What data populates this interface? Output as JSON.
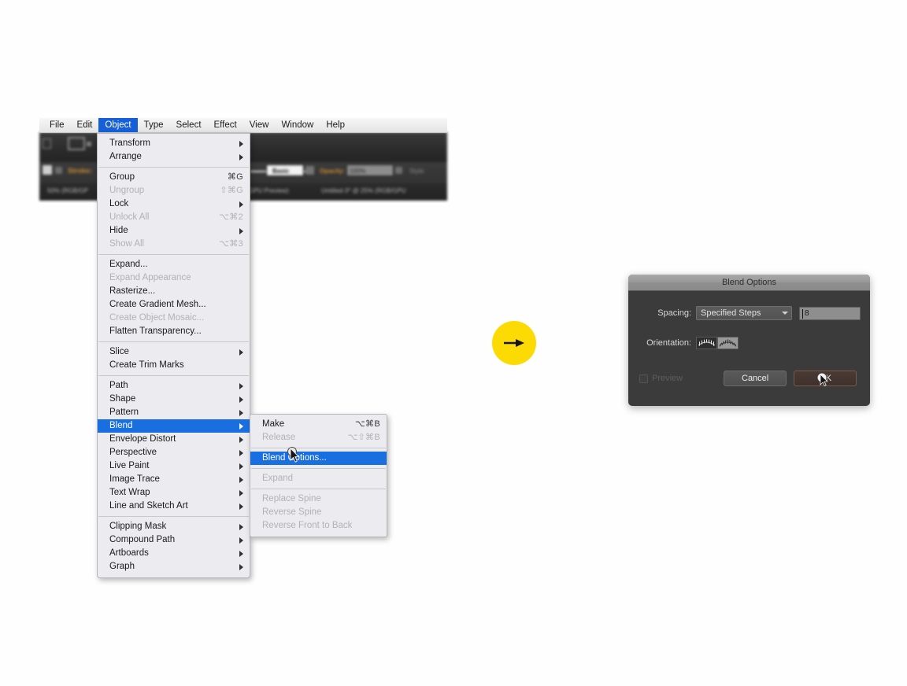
{
  "menubar": {
    "items": [
      {
        "label": "File",
        "active": false
      },
      {
        "label": "Edit",
        "active": false
      },
      {
        "label": "Object",
        "active": true
      },
      {
        "label": "Type",
        "active": false
      },
      {
        "label": "Select",
        "active": false
      },
      {
        "label": "Effect",
        "active": false
      },
      {
        "label": "View",
        "active": false
      },
      {
        "label": "Window",
        "active": false
      },
      {
        "label": "Help",
        "active": false
      }
    ]
  },
  "app_chrome": {
    "stroke_label": "Stroke:",
    "basic_label": "Basic",
    "opacity_label": "Opacity:",
    "opacity_value": "100%",
    "style_label": "Style:",
    "zoom_status": "50% (RGB/GP",
    "gpu_preview": "GPU Preview)",
    "document_tab": "Untitled-3* @ 25% (RGB/GPU"
  },
  "object_menu": {
    "groups": [
      [
        {
          "label": "Transform",
          "shortcut": "",
          "submenu": true,
          "disabled": false,
          "selected": false
        },
        {
          "label": "Arrange",
          "shortcut": "",
          "submenu": true,
          "disabled": false,
          "selected": false
        }
      ],
      [
        {
          "label": "Group",
          "shortcut": "⌘G",
          "submenu": false,
          "disabled": false,
          "selected": false
        },
        {
          "label": "Ungroup",
          "shortcut": "⇧⌘G",
          "submenu": false,
          "disabled": true,
          "selected": false
        },
        {
          "label": "Lock",
          "shortcut": "",
          "submenu": true,
          "disabled": false,
          "selected": false
        },
        {
          "label": "Unlock All",
          "shortcut": "⌥⌘2",
          "submenu": false,
          "disabled": true,
          "selected": false
        },
        {
          "label": "Hide",
          "shortcut": "",
          "submenu": true,
          "disabled": false,
          "selected": false
        },
        {
          "label": "Show All",
          "shortcut": "⌥⌘3",
          "submenu": false,
          "disabled": true,
          "selected": false
        }
      ],
      [
        {
          "label": "Expand...",
          "shortcut": "",
          "submenu": false,
          "disabled": false,
          "selected": false
        },
        {
          "label": "Expand Appearance",
          "shortcut": "",
          "submenu": false,
          "disabled": true,
          "selected": false
        },
        {
          "label": "Rasterize...",
          "shortcut": "",
          "submenu": false,
          "disabled": false,
          "selected": false
        },
        {
          "label": "Create Gradient Mesh...",
          "shortcut": "",
          "submenu": false,
          "disabled": false,
          "selected": false
        },
        {
          "label": "Create Object Mosaic...",
          "shortcut": "",
          "submenu": false,
          "disabled": true,
          "selected": false
        },
        {
          "label": "Flatten Transparency...",
          "shortcut": "",
          "submenu": false,
          "disabled": false,
          "selected": false
        }
      ],
      [
        {
          "label": "Slice",
          "shortcut": "",
          "submenu": true,
          "disabled": false,
          "selected": false
        },
        {
          "label": "Create Trim Marks",
          "shortcut": "",
          "submenu": false,
          "disabled": false,
          "selected": false
        }
      ],
      [
        {
          "label": "Path",
          "shortcut": "",
          "submenu": true,
          "disabled": false,
          "selected": false
        },
        {
          "label": "Shape",
          "shortcut": "",
          "submenu": true,
          "disabled": false,
          "selected": false
        },
        {
          "label": "Pattern",
          "shortcut": "",
          "submenu": true,
          "disabled": false,
          "selected": false
        },
        {
          "label": "Blend",
          "shortcut": "",
          "submenu": true,
          "disabled": false,
          "selected": true
        },
        {
          "label": "Envelope Distort",
          "shortcut": "",
          "submenu": true,
          "disabled": false,
          "selected": false
        },
        {
          "label": "Perspective",
          "shortcut": "",
          "submenu": true,
          "disabled": false,
          "selected": false
        },
        {
          "label": "Live Paint",
          "shortcut": "",
          "submenu": true,
          "disabled": false,
          "selected": false
        },
        {
          "label": "Image Trace",
          "shortcut": "",
          "submenu": true,
          "disabled": false,
          "selected": false
        },
        {
          "label": "Text Wrap",
          "shortcut": "",
          "submenu": true,
          "disabled": false,
          "selected": false
        },
        {
          "label": "Line and Sketch Art",
          "shortcut": "",
          "submenu": true,
          "disabled": false,
          "selected": false
        }
      ],
      [
        {
          "label": "Clipping Mask",
          "shortcut": "",
          "submenu": true,
          "disabled": false,
          "selected": false
        },
        {
          "label": "Compound Path",
          "shortcut": "",
          "submenu": true,
          "disabled": false,
          "selected": false
        },
        {
          "label": "Artboards",
          "shortcut": "",
          "submenu": true,
          "disabled": false,
          "selected": false
        },
        {
          "label": "Graph",
          "shortcut": "",
          "submenu": true,
          "disabled": false,
          "selected": false
        }
      ]
    ]
  },
  "blend_submenu": {
    "groups": [
      [
        {
          "label": "Make",
          "shortcut": "⌥⌘B",
          "submenu": false,
          "disabled": false,
          "selected": false
        },
        {
          "label": "Release",
          "shortcut": "⌥⇧⌘B",
          "submenu": false,
          "disabled": true,
          "selected": false
        }
      ],
      [
        {
          "label": "Blend Options...",
          "shortcut": "",
          "submenu": false,
          "disabled": false,
          "selected": true
        }
      ],
      [
        {
          "label": "Expand",
          "shortcut": "",
          "submenu": false,
          "disabled": true,
          "selected": false
        }
      ],
      [
        {
          "label": "Replace Spine",
          "shortcut": "",
          "submenu": false,
          "disabled": true,
          "selected": false
        },
        {
          "label": "Reverse Spine",
          "shortcut": "",
          "submenu": false,
          "disabled": true,
          "selected": false
        },
        {
          "label": "Reverse Front to Back",
          "shortcut": "",
          "submenu": false,
          "disabled": true,
          "selected": false
        }
      ]
    ]
  },
  "dialog": {
    "title": "Blend Options",
    "spacing_label": "Spacing:",
    "spacing_value": "Specified Steps",
    "steps_value": "8",
    "orientation_label": "Orientation:",
    "orientation_options": [
      "align-to-page",
      "align-to-path"
    ],
    "orientation_selected": 1,
    "preview_label": "Preview",
    "preview_checked": false,
    "cancel_label": "Cancel",
    "ok_label": "OK"
  },
  "annotation": {
    "arrow_badge": "right-arrow",
    "badge_color": "#fcdb04"
  },
  "colors": {
    "menu_highlight": "#1a6fe0",
    "menubar_active": "#1560d8",
    "dialog_bg": "#3b3b3b",
    "ok_button": "#4a3a34"
  }
}
